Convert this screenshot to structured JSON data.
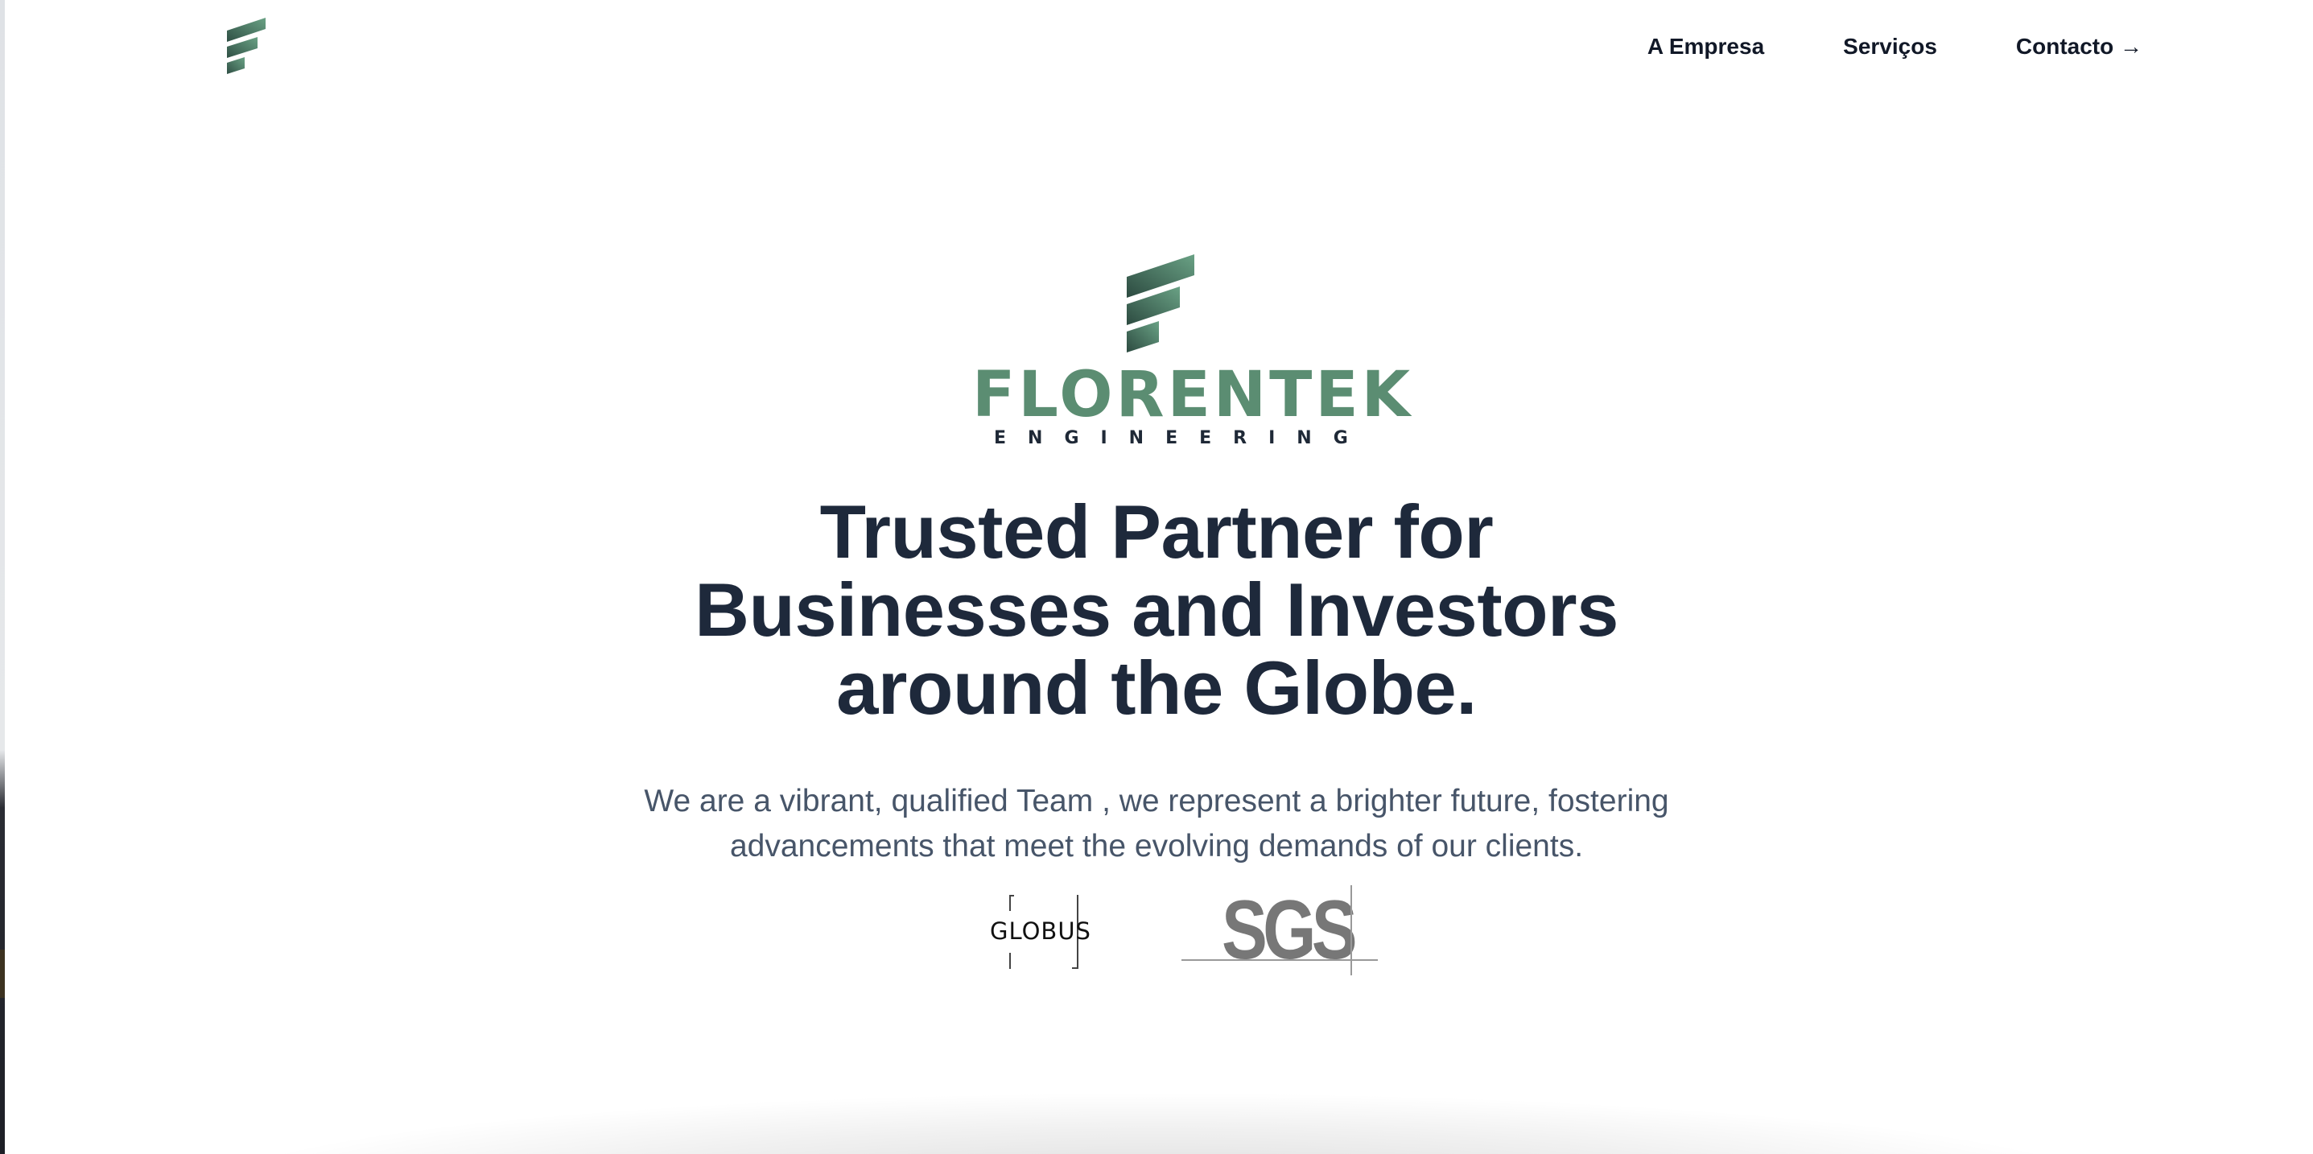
{
  "brand": {
    "logo_icon": "florentek-f-mark-icon",
    "name": "FLORENTEK",
    "tagline": "ENGINEERING",
    "colors": {
      "green": "#5b8d72",
      "dark": "#1e293b"
    }
  },
  "nav": {
    "items": [
      {
        "label": "A Empresa"
      },
      {
        "label": "Serviços"
      },
      {
        "label": "Contacto →"
      }
    ]
  },
  "hero": {
    "headline_lines": [
      "Trusted Partner for",
      "Businesses and Investors",
      "around the Globe."
    ],
    "lead_lines": [
      "We are a vibrant, qualified Team , we represent a brighter future, fostering",
      "advancements that meet the evolving demands of our clients."
    ]
  },
  "partners": [
    {
      "name": "GLOBUS",
      "icon": "globus-logo"
    },
    {
      "name": "SGS",
      "icon": "sgs-logo"
    }
  ]
}
